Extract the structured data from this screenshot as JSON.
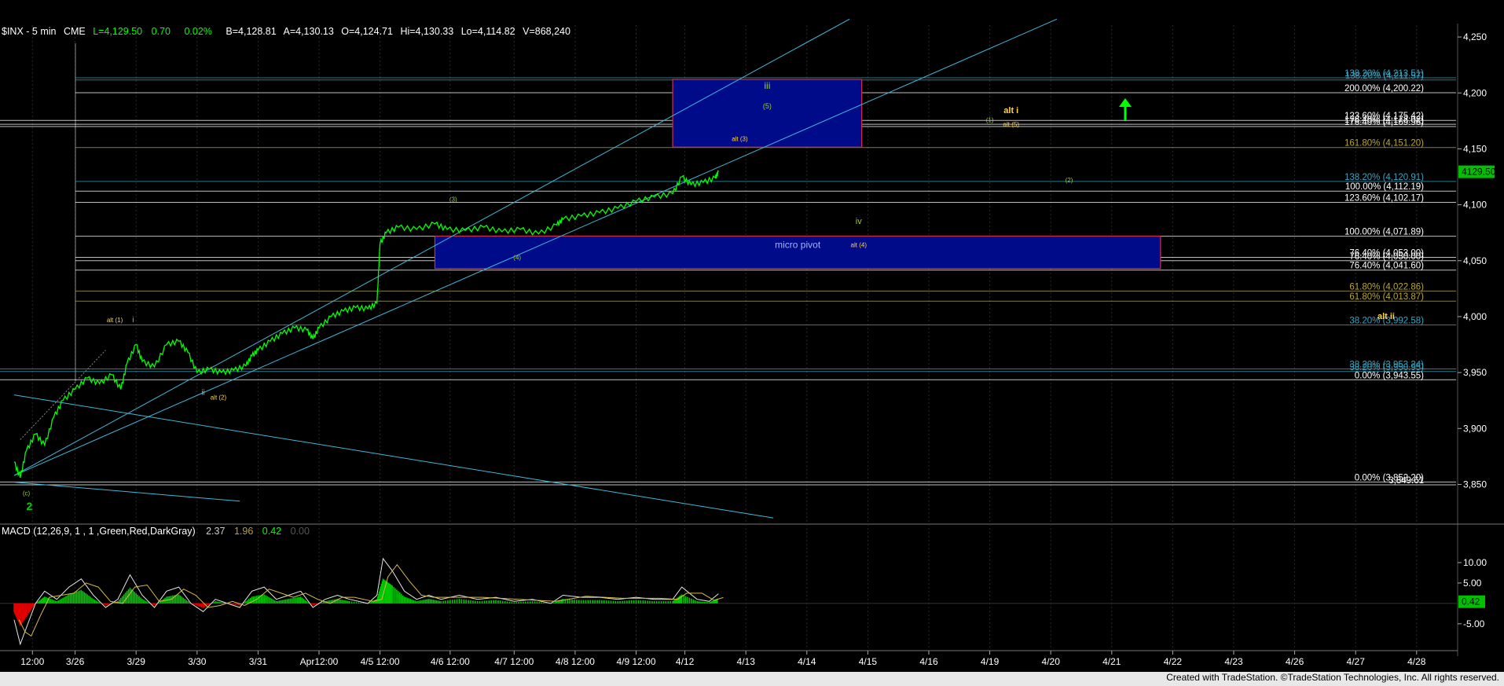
{
  "header": {
    "symbol": "$INX - 5 min",
    "exchange": "CME",
    "last": "L=4,129.50",
    "change": "0.70",
    "pct": "0.02%",
    "bid": "B=4,128.81",
    "ask": "A=4,130.13",
    "open": "O=4,124.71",
    "high": "Hi=4,130.33",
    "low": "Lo=4,114.82",
    "volume": "V=868,240"
  },
  "macd_header": {
    "name": "MACD (12,26,9, 1 , 1 ,Green,Red,DarkGray)",
    "v1": "2.37",
    "v2": "1.96",
    "v3": "0.42",
    "v4": "0.00"
  },
  "colors": {
    "price": "#00ff00",
    "channel": "#3fb8d8",
    "fib_white": "#ffffff",
    "fib_yellow": "#b8a630",
    "fib_teal": "#3aa3bf",
    "box": "#000b8a",
    "macd_up": "#00c800",
    "macd_down": "#e00000"
  },
  "price_axis": {
    "ticks": [
      {
        "label": "4,250",
        "v": 4250
      },
      {
        "label": "4,200",
        "v": 4200
      },
      {
        "label": "4,150",
        "v": 4150
      },
      {
        "label": "4,100",
        "v": 4100
      },
      {
        "label": "4,050",
        "v": 4050
      },
      {
        "label": "4,000",
        "v": 4000
      },
      {
        "label": "3,950",
        "v": 3950
      },
      {
        "label": "3,900",
        "v": 3900
      },
      {
        "label": "3,850",
        "v": 3850
      }
    ],
    "last_price": "4129.50",
    "range": [
      3818,
      4262
    ]
  },
  "macd_axis": {
    "ticks": [
      {
        "label": "10.00",
        "v": 10
      },
      {
        "label": "5.00",
        "v": 5
      },
      {
        "label": "-5.00",
        "v": -5
      }
    ],
    "current": "0.42",
    "range": [
      -11,
      15
    ]
  },
  "time_axis": {
    "labels": [
      {
        "label": "12:00",
        "t": 0.3
      },
      {
        "label": "3/26",
        "t": 1
      },
      {
        "label": "3/29",
        "t": 2
      },
      {
        "label": "3/30",
        "t": 3
      },
      {
        "label": "3/31",
        "t": 4
      },
      {
        "label": "Apr12:00",
        "t": 5
      },
      {
        "label": "4/5 12:00",
        "t": 6
      },
      {
        "label": "4/6 12:00",
        "t": 7.15
      },
      {
        "label": "4/7 12:00",
        "t": 8.2
      },
      {
        "label": "4/8 12:00",
        "t": 9.2
      },
      {
        "label": "4/9 12:00",
        "t": 10.2
      },
      {
        "label": "4/12",
        "t": 11
      },
      {
        "label": "4/13",
        "t": 12
      },
      {
        "label": "4/14",
        "t": 13
      },
      {
        "label": "4/15",
        "t": 14
      },
      {
        "label": "4/16",
        "t": 15
      },
      {
        "label": "4/19",
        "t": 16
      },
      {
        "label": "4/20",
        "t": 17
      },
      {
        "label": "4/21",
        "t": 18
      },
      {
        "label": "4/22",
        "t": 19
      },
      {
        "label": "4/23",
        "t": 20
      },
      {
        "label": "4/26",
        "t": 21
      },
      {
        "label": "4/27",
        "t": 22
      },
      {
        "label": "4/28",
        "t": 23
      }
    ]
  },
  "chart_data": {
    "type": "line",
    "series": [
      {
        "name": "$INX - 5 min",
        "points": [
          [
            0.0,
            3870
          ],
          [
            0.1,
            3856
          ],
          [
            0.2,
            3880
          ],
          [
            0.35,
            3895
          ],
          [
            0.5,
            3885
          ],
          [
            0.65,
            3910
          ],
          [
            0.8,
            3925
          ],
          [
            1.0,
            3935
          ],
          [
            1.2,
            3945
          ],
          [
            1.4,
            3940
          ],
          [
            1.6,
            3948
          ],
          [
            1.75,
            3935
          ],
          [
            1.85,
            3958
          ],
          [
            2.0,
            3975
          ],
          [
            2.1,
            3960
          ],
          [
            2.3,
            3955
          ],
          [
            2.5,
            3975
          ],
          [
            2.7,
            3978
          ],
          [
            2.85,
            3968
          ],
          [
            3.0,
            3950
          ],
          [
            3.2,
            3953
          ],
          [
            3.4,
            3950
          ],
          [
            3.6,
            3952
          ],
          [
            3.8,
            3956
          ],
          [
            3.9,
            3965
          ],
          [
            4.0,
            3970
          ],
          [
            4.2,
            3978
          ],
          [
            4.4,
            3985
          ],
          [
            4.6,
            3990
          ],
          [
            4.8,
            3988
          ],
          [
            4.9,
            3980
          ],
          [
            5.0,
            3990
          ],
          [
            5.2,
            4000
          ],
          [
            5.4,
            4005
          ],
          [
            5.6,
            4008
          ],
          [
            5.8,
            4007
          ],
          [
            5.95,
            4012
          ],
          [
            6.0,
            4065
          ],
          [
            6.1,
            4075
          ],
          [
            6.3,
            4080
          ],
          [
            6.6,
            4078
          ],
          [
            6.9,
            4083
          ],
          [
            7.1,
            4078
          ],
          [
            7.4,
            4077
          ],
          [
            7.7,
            4080
          ],
          [
            8.0,
            4076
          ],
          [
            8.3,
            4078
          ],
          [
            8.6,
            4074
          ],
          [
            8.9,
            4082
          ],
          [
            9.0,
            4087
          ],
          [
            9.3,
            4090
          ],
          [
            9.6,
            4093
          ],
          [
            9.9,
            4097
          ],
          [
            10.2,
            4103
          ],
          [
            10.5,
            4107
          ],
          [
            10.8,
            4110
          ],
          [
            10.95,
            4125
          ],
          [
            11.1,
            4118
          ],
          [
            11.3,
            4120
          ],
          [
            11.5,
            4124
          ],
          [
            11.55,
            4129.5
          ]
        ]
      },
      {
        "name": "MACD",
        "points": [
          [
            0.0,
            -4
          ],
          [
            0.1,
            -10
          ],
          [
            0.2,
            -6
          ],
          [
            0.35,
            0
          ],
          [
            0.5,
            3
          ],
          [
            0.7,
            1
          ],
          [
            0.9,
            4
          ],
          [
            1.1,
            6
          ],
          [
            1.3,
            2
          ],
          [
            1.5,
            -1
          ],
          [
            1.7,
            1
          ],
          [
            1.9,
            7
          ],
          [
            2.1,
            2
          ],
          [
            2.3,
            -1
          ],
          [
            2.5,
            3
          ],
          [
            2.7,
            4
          ],
          [
            2.9,
            0
          ],
          [
            3.1,
            -2
          ],
          [
            3.3,
            1
          ],
          [
            3.5,
            0
          ],
          [
            3.7,
            -1
          ],
          [
            3.9,
            3
          ],
          [
            4.1,
            4
          ],
          [
            4.3,
            1
          ],
          [
            4.5,
            2
          ],
          [
            4.7,
            3
          ],
          [
            4.9,
            -1
          ],
          [
            5.1,
            1
          ],
          [
            5.3,
            2
          ],
          [
            5.5,
            1
          ],
          [
            5.8,
            0
          ],
          [
            5.95,
            2
          ],
          [
            6.05,
            11
          ],
          [
            6.2,
            8
          ],
          [
            6.4,
            3
          ],
          [
            6.6,
            1
          ],
          [
            6.8,
            2
          ],
          [
            7.0,
            1
          ],
          [
            7.3,
            2
          ],
          [
            7.6,
            1
          ],
          [
            7.9,
            1.5
          ],
          [
            8.2,
            0.5
          ],
          [
            8.5,
            1
          ],
          [
            8.8,
            0
          ],
          [
            9.0,
            2
          ],
          [
            9.3,
            1.5
          ],
          [
            9.6,
            1.5
          ],
          [
            9.9,
            1
          ],
          [
            10.2,
            1.5
          ],
          [
            10.5,
            1
          ],
          [
            10.8,
            1
          ],
          [
            10.95,
            4
          ],
          [
            11.2,
            1
          ],
          [
            11.4,
            0.5
          ],
          [
            11.55,
            2.37
          ]
        ]
      }
    ]
  },
  "fib_levels": [
    {
      "label": "138.20% (4,213.51)",
      "v": 4213.51,
      "color": "#3aa3bf"
    },
    {
      "label": "138.20% (4,211.57)",
      "v": 4211.57,
      "color": "#3aa3bf"
    },
    {
      "label": "200.00% (4,200.22)",
      "v": 4200.22,
      "color": "#ffffff"
    },
    {
      "label": "123.60% (4,175.42)",
      "v": 4175.42,
      "color": "#ffffff"
    },
    {
      "label": "176.40% (4,172.02)",
      "v": 4172.02,
      "color": "#ffffff"
    },
    {
      "label": "176.40% (4,169.96)",
      "v": 4169.96,
      "color": "#ffffff"
    },
    {
      "label": "161.80% (4,151.20)",
      "v": 4151.2,
      "color": "#b8a630"
    },
    {
      "label": "138.20% (4,120.91)",
      "v": 4120.91,
      "color": "#3aa3bf"
    },
    {
      "label": "100.00% (4,112.19)",
      "v": 4112.19,
      "color": "#ffffff"
    },
    {
      "label": "123.60% (4,102.17)",
      "v": 4102.17,
      "color": "#ffffff"
    },
    {
      "label": "100.00% (4,071.89)",
      "v": 4071.89,
      "color": "#ffffff"
    },
    {
      "label": "76.40% (4,053.00)",
      "v": 4053.0,
      "color": "#ffffff"
    },
    {
      "label": "76.40% (4,050.00)",
      "v": 4050.0,
      "color": "#ffffff"
    },
    {
      "label": "76.40% (4,041.60)",
      "v": 4041.6,
      "color": "#ffffff"
    },
    {
      "label": "61.80% (4,022.86)",
      "v": 4022.86,
      "color": "#b8a630"
    },
    {
      "label": "61.80% (4,013.87)",
      "v": 4013.87,
      "color": "#b8a630"
    },
    {
      "label": "38.20% (3,992.58)",
      "v": 3992.58,
      "color": "#3aa3bf"
    },
    {
      "label": "38.20% (3,953.24)",
      "v": 3953.24,
      "color": "#3aa3bf"
    },
    {
      "label": "38.20% (3,950.95)",
      "v": 3950.95,
      "color": "#3aa3bf"
    },
    {
      "label": "0.00% (3,943.55)",
      "v": 3943.55,
      "color": "#ffffff"
    },
    {
      "label": "0.00% (3,852.20)",
      "v": 3852.2,
      "color": "#ffffff"
    },
    {
      "label": "3,849.61",
      "v": 3849.61,
      "color": "#ffffff"
    }
  ],
  "boxes": [
    {
      "label": "iii",
      "sublabel": "(5)",
      "t0": 10.8,
      "t1": 13.9,
      "v0": 4151.5,
      "v1": 4212
    },
    {
      "label": "micro pivot",
      "t0": 6.9,
      "t1": 18.8,
      "v0": 4043,
      "v1": 4072
    }
  ],
  "wave_labels": [
    {
      "text": "alt i",
      "t": 16.35,
      "v": 4182,
      "color": "#ffd24a",
      "bold": true,
      "size": 11
    },
    {
      "text": "alt (5)",
      "t": 16.35,
      "v": 4170,
      "color": "#ffd24a",
      "size": 8
    },
    {
      "text": "(1)",
      "t": 16.0,
      "v": 4174,
      "color": "#9acd32",
      "size": 8
    },
    {
      "text": "alt (3)",
      "t": 11.9,
      "v": 4157,
      "color": "#ffd24a",
      "size": 8
    },
    {
      "text": "(2)",
      "t": 17.3,
      "v": 4120,
      "color": "#9acd32",
      "size": 8
    },
    {
      "text": "iv",
      "t": 13.85,
      "v": 4083,
      "color": "#9acd32",
      "size": 11
    },
    {
      "text": "alt (4)",
      "t": 13.85,
      "v": 4062,
      "color": "#ffd24a",
      "size": 8
    },
    {
      "text": "(3)",
      "t": 7.2,
      "v": 4103,
      "color": "#9acd32",
      "size": 8
    },
    {
      "text": "(4)",
      "t": 8.25,
      "v": 4051,
      "color": "#9acd32",
      "size": 8
    },
    {
      "text": "alt ii",
      "t": 22.5,
      "v": 3998,
      "color": "#ffd24a",
      "bold": true,
      "size": 11
    },
    {
      "text": "alt (1)",
      "t": 1.65,
      "v": 3995,
      "color": "#ffd24a",
      "size": 8
    },
    {
      "text": "i",
      "t": 1.95,
      "v": 3995,
      "color": "#9acd32",
      "size": 10
    },
    {
      "text": "ii",
      "t": 3.1,
      "v": 3930,
      "color": "#9acd32",
      "size": 10
    },
    {
      "text": "alt (2)",
      "t": 3.35,
      "v": 3926,
      "color": "#ffd24a",
      "size": 8
    },
    {
      "text": "(c)",
      "t": 0.2,
      "v": 3840,
      "color": "#9acd32",
      "size": 8
    },
    {
      "text": "2",
      "t": 0.25,
      "v": 3827,
      "color": "#00d000",
      "bold": true,
      "size": 14
    }
  ],
  "credit": "Created with TradeStation. ©TradeStation Technologies, Inc. All rights reserved."
}
